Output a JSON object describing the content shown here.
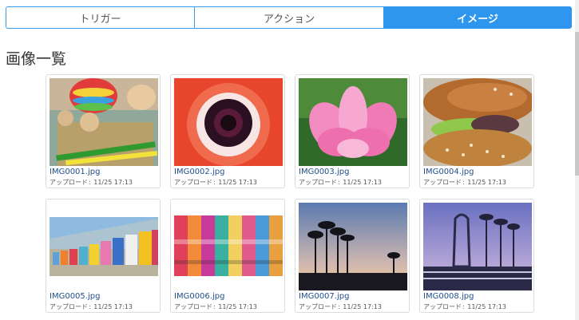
{
  "tabs": [
    {
      "label": "トリガー",
      "active": false
    },
    {
      "label": "アクション",
      "active": false
    },
    {
      "label": "イメージ",
      "active": true
    }
  ],
  "page_title": "画像一覧",
  "upload_label": "アップロード",
  "images": [
    {
      "name": "IMG0001.jpg",
      "uploaded": "11/25 17:13",
      "subject": "wooden toy and crayons"
    },
    {
      "name": "IMG0002.jpg",
      "uploaded": "11/25 17:13",
      "subject": "red anemone flower"
    },
    {
      "name": "IMG0003.jpg",
      "uploaded": "11/25 17:13",
      "subject": "pink lotus flower"
    },
    {
      "name": "IMG0004.jpg",
      "uploaded": "11/25 17:13",
      "subject": "sandwich"
    },
    {
      "name": "IMG0005.jpg",
      "uploaded": "11/25 17:13",
      "subject": "colorful beach huts"
    },
    {
      "name": "IMG0006.jpg",
      "uploaded": "11/25 17:13",
      "subject": "colorful hanging fabrics"
    },
    {
      "name": "IMG0007.jpg",
      "uploaded": "11/25 17:13",
      "subject": "palm trees at sunset"
    },
    {
      "name": "IMG0008.jpg",
      "uploaded": "11/25 17:13",
      "subject": "palm trees and monument at dusk"
    }
  ]
}
